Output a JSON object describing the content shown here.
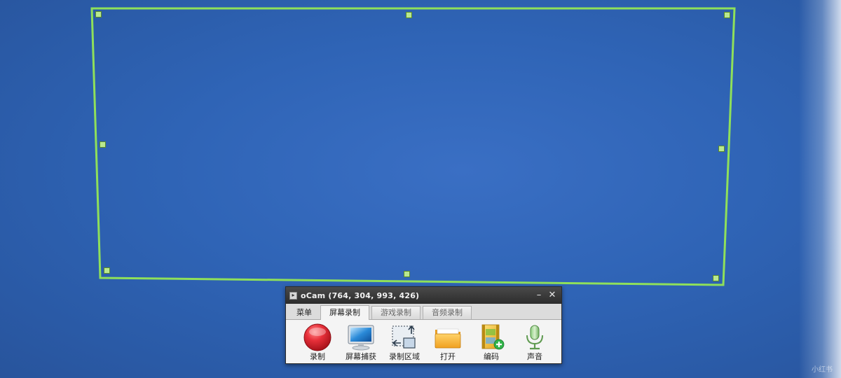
{
  "window": {
    "title": "oCam (764, 304, 993, 426)",
    "minimize_glyph": "–",
    "close_glyph": "✕",
    "app_icon_glyph": "▸"
  },
  "tabs": [
    {
      "label": "菜单",
      "state": "menu"
    },
    {
      "label": "屏幕录制",
      "state": "active"
    },
    {
      "label": "游戏录制",
      "state": "inactive"
    },
    {
      "label": "音频录制",
      "state": "inactive"
    }
  ],
  "toolbar": {
    "record_label": "录制",
    "screenshot_label": "屏幕捕获",
    "region_label": "录制区域",
    "open_label": "打开",
    "codec_label": "编码",
    "sound_label": "声音"
  },
  "icons": {
    "record": "record-icon",
    "screenshot": "monitor-icon",
    "region": "resize-region-icon",
    "open": "folder-icon",
    "codec": "film-add-icon",
    "sound": "microphone-icon"
  },
  "colors": {
    "desktop_blue": "#2f64b6",
    "frame_green": "#8fe05a",
    "record_red": "#e8303a",
    "titlebar_dark": "#333333"
  },
  "watermark": "小红书"
}
